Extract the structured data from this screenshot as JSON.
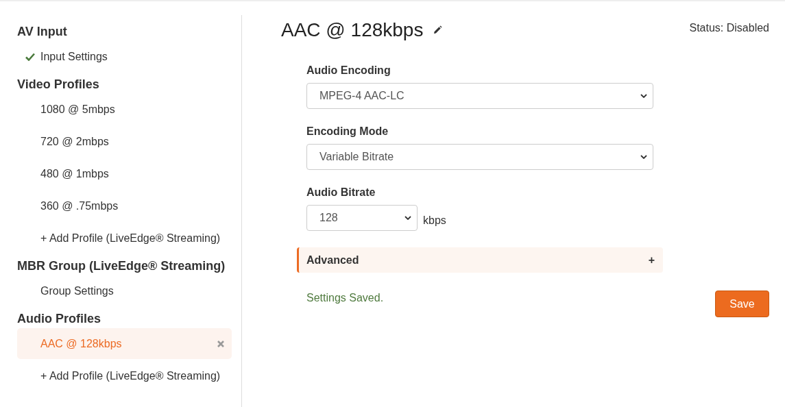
{
  "sidebar": {
    "sections": [
      {
        "title": "AV Input",
        "items": [
          {
            "label": "Input Settings",
            "checked": true,
            "selected": false,
            "removable": false
          }
        ]
      },
      {
        "title": "Video Profiles",
        "items": [
          {
            "label": "1080 @ 5mbps",
            "checked": false,
            "selected": false,
            "removable": false
          },
          {
            "label": "720 @ 2mbps",
            "checked": false,
            "selected": false,
            "removable": false
          },
          {
            "label": "480 @ 1mbps",
            "checked": false,
            "selected": false,
            "removable": false
          },
          {
            "label": "360 @ .75mbps",
            "checked": false,
            "selected": false,
            "removable": false
          },
          {
            "label": "+ Add Profile (LiveEdge® Streaming)",
            "checked": false,
            "selected": false,
            "removable": false
          }
        ]
      },
      {
        "title": "MBR Group (LiveEdge® Streaming)",
        "items": [
          {
            "label": "Group Settings",
            "checked": false,
            "selected": false,
            "removable": false
          }
        ]
      },
      {
        "title": "Audio Profiles",
        "items": [
          {
            "label": "AAC @ 128kbps",
            "checked": false,
            "selected": true,
            "removable": true
          },
          {
            "label": "+ Add Profile (LiveEdge® Streaming)",
            "checked": false,
            "selected": false,
            "removable": false
          }
        ]
      }
    ]
  },
  "header": {
    "title": "AAC @ 128kbps",
    "status": "Status: Disabled"
  },
  "fields": [
    {
      "label": "Audio Encoding",
      "value": "MPEG-4 AAC-LC",
      "wide": true
    },
    {
      "label": "Encoding Mode",
      "value": "Variable Bitrate",
      "wide": true
    },
    {
      "label": "Audio Bitrate",
      "value": "128",
      "wide": false,
      "unit": "kbps"
    }
  ],
  "advanced": {
    "label": "Advanced",
    "toggle": "+",
    "expanded": false
  },
  "message": "Settings Saved.",
  "save_button": "Save"
}
